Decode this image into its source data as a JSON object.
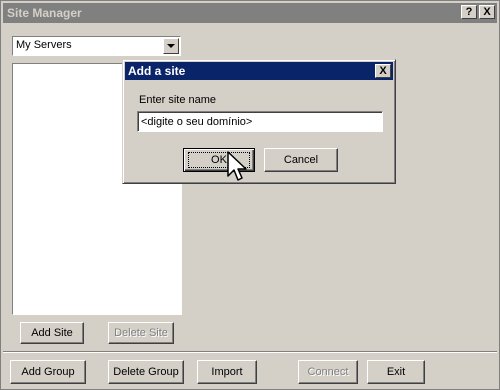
{
  "window": {
    "title": "Site Manager",
    "help_label": "?",
    "close_label": "X"
  },
  "combo": {
    "selected": "My Servers"
  },
  "buttons": {
    "add_site": "Add Site",
    "delete_site": "Delete Site",
    "add_group": "Add Group",
    "delete_group": "Delete Group",
    "import": "Import",
    "connect": "Connect",
    "exit": "Exit"
  },
  "dialog": {
    "title": "Add a site",
    "close_label": "X",
    "label": "Enter site name",
    "input_value": "<digite o seu domínio>",
    "ok_label": "OK",
    "cancel_label": "Cancel"
  },
  "colors": {
    "window_bg": "#d4d0c8",
    "inactive_title": "#808080",
    "active_title": "#0a246a"
  },
  "icons": [
    "help-icon",
    "close-icon",
    "dropdown-arrow-icon",
    "mouse-pointer-icon"
  ]
}
